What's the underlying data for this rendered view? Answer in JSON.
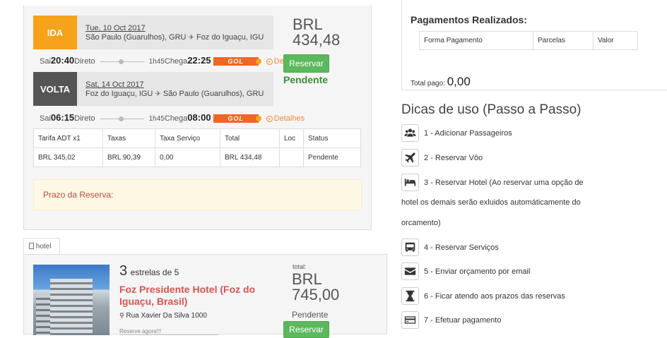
{
  "flights": {
    "outbound": {
      "tag": "IDA",
      "tag_color": "#f7a21b",
      "date": "Tue, 10 Oct 2017",
      "from": "São Paulo (Guarulhos), GRU",
      "to": "Foz do Iguaçu, IGU",
      "depart_label": "Sai",
      "depart_time": "20:40",
      "type": "Direto",
      "duration": "1h45",
      "arrive_label": "Chega",
      "arrive_time": "22:25",
      "airline": "GOL",
      "details_label": "Detalhes"
    },
    "inbound": {
      "tag": "VOLTA",
      "tag_color": "#555555",
      "date": "Sat, 14 Oct 2017",
      "from": "Foz do Iguaçu, IGU",
      "to": "São Paulo (Guarulhos), GRU",
      "depart_label": "Sai",
      "depart_time": "06:15",
      "type": "Direto",
      "duration": "1h45",
      "arrive_label": "Chega",
      "arrive_time": "08:00",
      "airline": "GOL",
      "details_label": "Detalhes"
    },
    "price_currency": "BRL",
    "price_value": "434,48",
    "reserve_label": "Reservar",
    "status": "Pendente",
    "fare_table": {
      "headers": [
        "Tarifa ADT x1",
        "Taxas",
        "Taxa Serviço",
        "Total",
        "Loc",
        "Status"
      ],
      "row": [
        "BRL 345,02",
        "BRL 90,39",
        "0,00",
        "BRL 434,48",
        "",
        "Pendente"
      ]
    },
    "prazo_label": "Prazo da Reserva:"
  },
  "hotel": {
    "tab_label": "hotel",
    "stars_count": "3",
    "stars_text": "estrelas de 5",
    "name": "Foz Presidente Hotel (Foz do Iguaçu, Brasil)",
    "address": "Rua Xavier Da Silva 1000",
    "reserve_now": "Reserve agora!!!",
    "total_label": "total:",
    "price_currency": "BRL",
    "price_value": "745,00",
    "status": "Pendente",
    "reserve_label": "Reservar",
    "close_label": "×"
  },
  "payments": {
    "title": "Pagamentos Realizados:",
    "columns": [
      "Forma Pagamento",
      "Parcelas",
      "Valor"
    ],
    "total_label": "Total pago:",
    "total_value": "0,00"
  },
  "tips": {
    "title": "Dicas de uso (Passo a Passo)",
    "items": [
      {
        "icon": "users-icon",
        "text": "1 - Adicionar Passageiros"
      },
      {
        "icon": "plane-icon",
        "text": "2 - Reservar Vôo"
      },
      {
        "icon": "bed-icon",
        "text": "3 - Reservar Hotel (Ao reservar uma opção de",
        "cont1": "hotel os demais serão exluidos automáticamente do",
        "cont2": "orcamento)"
      },
      {
        "icon": "bus-icon",
        "text": "4 - Reservar Serviços"
      },
      {
        "icon": "envelope-icon",
        "text": "5 - Enviar orçamento por email"
      },
      {
        "icon": "hourglass-icon",
        "text": "6 - Ficar atendo aos prazos das reservas"
      },
      {
        "icon": "credit-card-icon",
        "text": "7 - Efetuar pagamento"
      }
    ]
  },
  "colors": {
    "success": "#5cb85c",
    "warning_bg": "#fcf8e3",
    "danger_text": "#b94a48",
    "hotel_name": "#d9534f",
    "airline_orange": "#f26522"
  }
}
